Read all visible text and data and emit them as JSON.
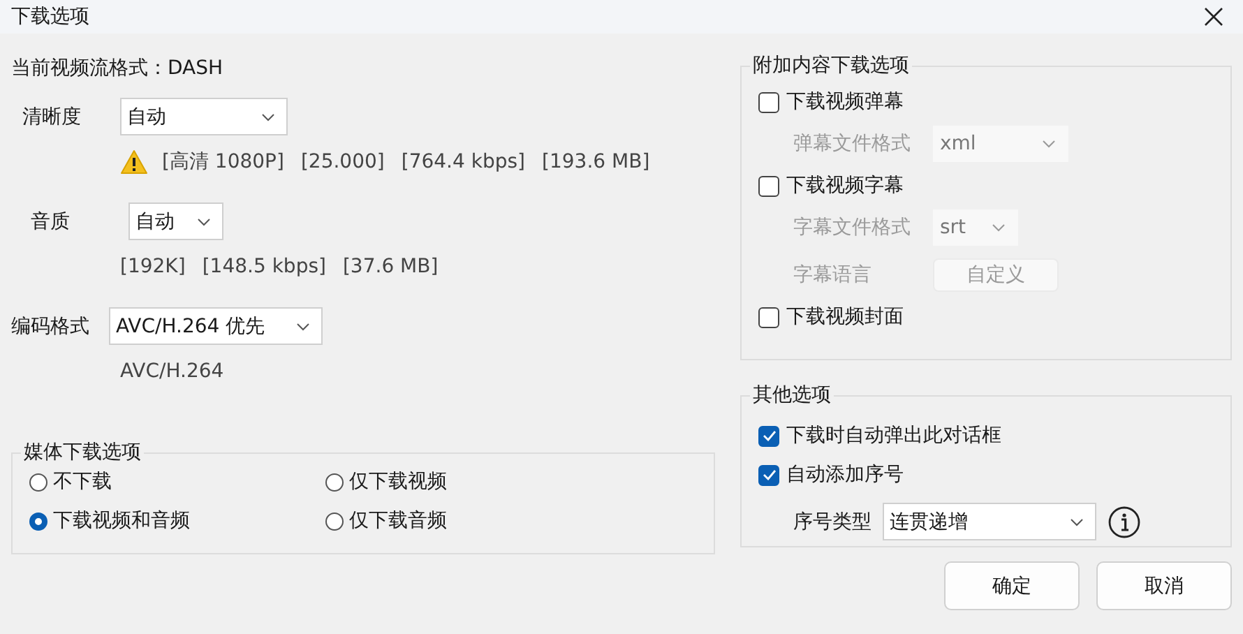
{
  "window": {
    "title": "下载选项"
  },
  "stream_format": "当前视频流格式：DASH",
  "quality": {
    "label": "清晰度",
    "value": "自动",
    "warning": true,
    "details": [
      "[高清 1080P]",
      "[25.000]",
      "[764.4 kbps]",
      "[193.6 MB]"
    ]
  },
  "audio": {
    "label": "音质",
    "value": "自动",
    "details": [
      "[192K]",
      "[148.5 kbps]",
      "[37.6 MB]"
    ]
  },
  "codec": {
    "label": "编码格式",
    "value": "AVC/H.264 优先",
    "details": [
      "AVC/H.264"
    ]
  },
  "media_options": {
    "title": "媒体下载选项",
    "options": [
      {
        "label": "不下载",
        "selected": false
      },
      {
        "label": "仅下载视频",
        "selected": false
      },
      {
        "label": "下载视频和音频",
        "selected": true
      },
      {
        "label": "仅下载音频",
        "selected": false
      }
    ]
  },
  "extra": {
    "title": "附加内容下载选项",
    "items": [
      {
        "kind": "checkbox",
        "label": "下载视频弹幕",
        "checked": false
      },
      {
        "kind": "select",
        "label": "弹幕文件格式",
        "value": "xml",
        "disabled": true
      },
      {
        "kind": "checkbox",
        "label": "下载视频字幕",
        "checked": false
      },
      {
        "kind": "select",
        "label": "字幕文件格式",
        "value": "srt",
        "disabled": true
      },
      {
        "kind": "button",
        "label": "字幕语言",
        "button": "自定义",
        "disabled": true
      },
      {
        "kind": "checkbox",
        "label": "下载视频封面",
        "checked": false
      }
    ]
  },
  "other": {
    "title": "其他选项",
    "checkboxes": [
      {
        "label": "下载时自动弹出此对话框",
        "checked": true
      },
      {
        "label": "自动添加序号",
        "checked": true
      }
    ],
    "sequence": {
      "label": "序号类型",
      "value": "连贯递增"
    }
  },
  "buttons": [
    "确定",
    "取消"
  ]
}
